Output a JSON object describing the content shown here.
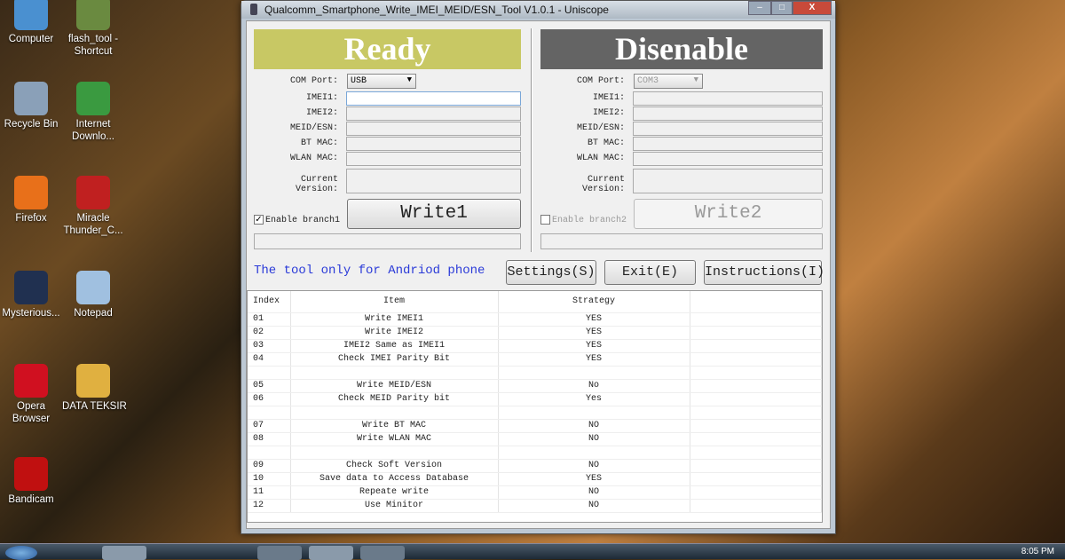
{
  "desktop": {
    "icons": [
      {
        "label": "Computer",
        "color": "#4a90d0"
      },
      {
        "label": "flash_tool -\nShortcut",
        "color": "#6a8a40"
      },
      {
        "label": "Recycle Bin",
        "color": "#8aa0b8"
      },
      {
        "label": "Internet\nDownlo...",
        "color": "#3a9a40"
      },
      {
        "label": "Firefox",
        "color": "#e8701a"
      },
      {
        "label": "Miracle\nThunder_C...",
        "color": "#c02020"
      },
      {
        "label": "Mysterious...",
        "color": "#203050"
      },
      {
        "label": "Notepad",
        "color": "#a0c0e0"
      },
      {
        "label": "Opera\nBrowser",
        "color": "#d01020"
      },
      {
        "label": "DATA TEKSIR",
        "color": "#e0b040"
      },
      {
        "label": "Bandicam",
        "color": "#c01010"
      }
    ]
  },
  "window": {
    "title": "Qualcomm_Smartphone_Write_IMEI_MEID/ESN_Tool V1.0.1  - Uniscope",
    "minimize": "–",
    "maximize": "□",
    "close": "X"
  },
  "left": {
    "status": "Ready",
    "status_color": "#c8c864",
    "com_label": "COM Port:",
    "com_value": "USB",
    "fields": [
      "IMEI1:",
      "IMEI2:",
      "MEID/ESN:",
      "BT MAC:",
      "WLAN MAC:"
    ],
    "version_label": "Current Version:",
    "enable_label": "Enable branch1",
    "enable_checked": true,
    "write": "Write1"
  },
  "right": {
    "status": "Disenable",
    "status_color": "#646464",
    "com_label": "COM Port:",
    "com_value": "COM3",
    "fields": [
      "IMEI1:",
      "IMEI2:",
      "MEID/ESN:",
      "BT MAC:",
      "WLAN MAC:"
    ],
    "version_label": "Current Version:",
    "enable_label": "Enable branch2",
    "enable_checked": false,
    "write": "Write2"
  },
  "notice": "The tool only for Andriod phone",
  "buttons": {
    "settings": "Settings(S)",
    "exit": "Exit(E)",
    "instructions": "Instructions(I)"
  },
  "table": {
    "headers": [
      "Index",
      "Item",
      "Strategy"
    ],
    "rows": [
      [
        "01",
        "Write IMEI1",
        "YES"
      ],
      [
        "02",
        "Write IMEI2",
        "YES"
      ],
      [
        "03",
        "IMEI2 Same as IMEI1",
        "YES"
      ],
      [
        "04",
        "Check IMEI Parity Bit",
        "YES"
      ],
      [
        "",
        "",
        ""
      ],
      [
        "05",
        "Write MEID/ESN",
        "No"
      ],
      [
        "06",
        "Check MEID Parity bit",
        "Yes"
      ],
      [
        "",
        "",
        ""
      ],
      [
        "07",
        "Write BT MAC",
        "NO"
      ],
      [
        "08",
        "Write WLAN MAC",
        "NO"
      ],
      [
        "",
        "",
        ""
      ],
      [
        "09",
        "Check Soft Version",
        "NO"
      ],
      [
        "10",
        "Save data to Access Database",
        "YES"
      ],
      [
        "11",
        "Repeate write",
        "NO"
      ],
      [
        "12",
        "Use Minitor",
        "NO"
      ]
    ]
  },
  "taskbar": {
    "clock": "8:05 PM"
  }
}
